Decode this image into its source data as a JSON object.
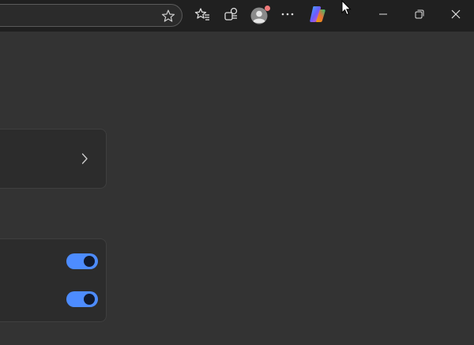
{
  "titlebar": {
    "address_bar_state": "partially-visible",
    "icons": {
      "favorite": "star-icon",
      "favorites": "favorites-icon",
      "collections": "collections-icon",
      "profile": "avatar",
      "more": "more-icon",
      "copilot": "copilot-icon",
      "minimize": "minimize-icon",
      "restore": "restore-icon",
      "close": "close-icon"
    }
  },
  "settings": {
    "cards": [
      {
        "kind": "navigation-row"
      },
      {
        "kind": "toggle-group",
        "toggles": [
          {
            "on": true
          },
          {
            "on": true
          }
        ]
      }
    ]
  },
  "colors": {
    "titlebar_bg": "#202020",
    "content_bg": "#333333",
    "card_bg": "#2c2c2c",
    "toggle_on": "#4d8cff",
    "profile_badge": "#f07a7a"
  }
}
